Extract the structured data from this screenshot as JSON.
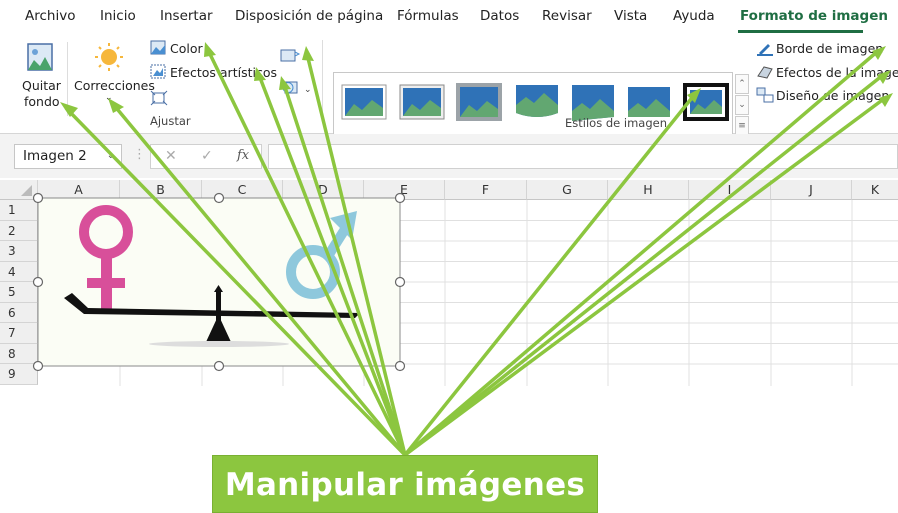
{
  "ribbon_tabs": [
    {
      "label": "Archivo"
    },
    {
      "label": "Inicio"
    },
    {
      "label": "Insertar"
    },
    {
      "label": "Disposición de página"
    },
    {
      "label": "Fórmulas"
    },
    {
      "label": "Datos"
    },
    {
      "label": "Revisar"
    },
    {
      "label": "Vista"
    },
    {
      "label": "Ayuda"
    },
    {
      "label": "Formato de imagen"
    }
  ],
  "ribbon": {
    "remove_bg_line1": "Quitar",
    "remove_bg_line2": "fondo",
    "corrections": "Correcciones",
    "color": "Color",
    "artistic": "Efectos artísticos",
    "adjust_group": "Ajustar",
    "styles_group": "Estilos de imagen",
    "border": "Borde de imagen",
    "effects": "Efectos de la imagen",
    "layout": "Diseño de imagen"
  },
  "formula_bar": {
    "name_box": "Imagen 2",
    "fx": "fx",
    "cancel": "✕",
    "enter": "✓"
  },
  "columns": [
    "A",
    "B",
    "C",
    "D",
    "E",
    "F",
    "G",
    "H",
    "I",
    "J",
    "K"
  ],
  "rows": [
    "1",
    "2",
    "3",
    "4",
    "5",
    "6",
    "7",
    "8",
    "9"
  ],
  "callout": "Manipular imágenes",
  "colors": {
    "accent": "#1f6e43",
    "arrow": "#8cc63f",
    "female": "#d84f9a",
    "male": "#8ec8dc"
  }
}
